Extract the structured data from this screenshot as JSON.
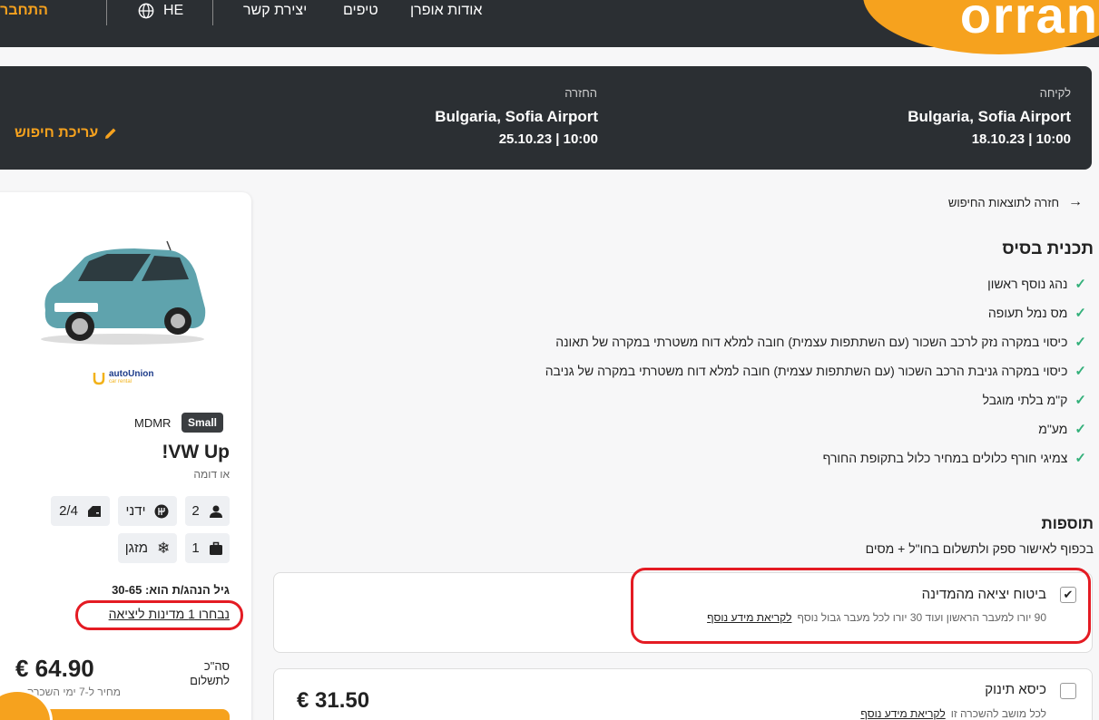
{
  "nav": {
    "logo": "orran",
    "login": "התחבר",
    "lang": "HE",
    "contact": "יצירת קשר",
    "tips": "טיפים",
    "about": "אודות אופרן"
  },
  "summary": {
    "pickup_label": "לקיחה",
    "pickup_place": "Bulgaria, Sofia Airport",
    "pickup_datetime": "18.10.23 | 10:00",
    "return_label": "החזרה",
    "return_place": "Bulgaria, Sofia Airport",
    "return_datetime": "25.10.23 | 10:00",
    "edit_label": "עריכת חיפוש"
  },
  "main": {
    "back_link": "חזרה לתוצאות החיפוש",
    "plan_title": "תכנית בסיס",
    "features": [
      "נהג נוסף ראשון",
      "מס נמל תעופה",
      "כיסוי במקרה נזק לרכב השכור (עם השתתפות עצמית) חובה למלא דוח משטרתי במקרה של תאונה",
      "כיסוי במקרה גניבת הרכב השכור (עם השתתפות עצמית) חובה למלא דוח משטרתי במקרה של גניבה",
      "ק\"מ בלתי מוגבל",
      "מע\"מ",
      "צמיגי חורף כלולים במחיר כלול בתקופת החורף"
    ],
    "addons_title": "תוספות",
    "addons_subtitle": "בכפוף לאישור ספק ולתשלום בחו\"ל + מסים",
    "addons": [
      {
        "title": "ביטוח יציאה מהמדינה",
        "description": "90 יורו למעבר הראשון ועוד 30 יורו לכל מעבר גבול נוסף",
        "more_link": "לקריאת מידע נוסף",
        "checked": true,
        "price": ""
      },
      {
        "title": "כיסא תינוק",
        "description": "לכל מושב להשכרה זו",
        "more_link": "לקריאת מידע נוסף",
        "checked": false,
        "price": "€ 31.50"
      }
    ]
  },
  "car": {
    "supplier": "autoUnion",
    "supplier_sub": "car rental",
    "category_badge": "Small",
    "code": "MDMR",
    "name": "VW Up!",
    "similar": "או דומה",
    "passengers": "2",
    "transmission": "ידני",
    "doors": "2/4",
    "bags": "1",
    "ac": "מזגן",
    "driver_age": "גיל הנהג/ת הוא: 30-65",
    "countries_link": "נבחרו 1 מדינות ליציאה",
    "total_label": "סה\"כ",
    "total_label2": "לתשלום",
    "total_price": "€ 64.90",
    "price_note": "מחיר ל-7 ימי השכרה"
  },
  "colors": {
    "accent": "#f6a21e",
    "dark": "#2b2f33",
    "check": "#33b07a",
    "highlight": "#e41b23"
  }
}
